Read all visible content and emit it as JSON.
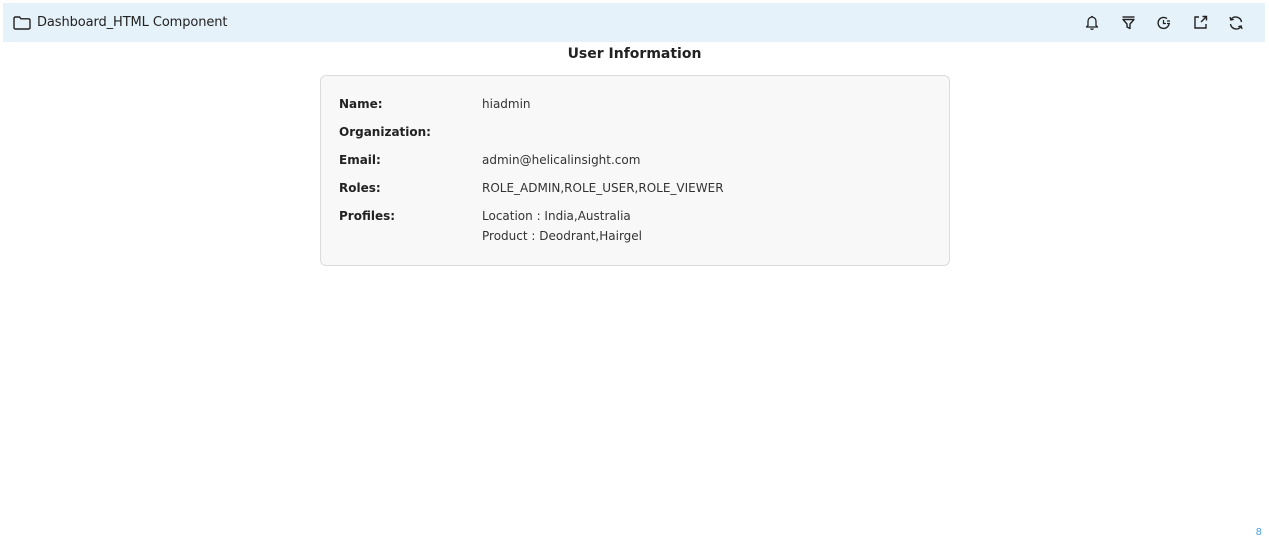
{
  "header": {
    "breadcrumb": "Dashboard_HTML Component",
    "toolbar_icons": [
      "bell-icon",
      "filter-icon",
      "schedule-icon",
      "export-icon",
      "refresh-icon"
    ]
  },
  "main": {
    "title": "User Information",
    "fields": [
      {
        "label": "Name:",
        "value": "hiadmin"
      },
      {
        "label": "Organization:",
        "value": ""
      },
      {
        "label": "Email:",
        "value": "admin@helicalinsight.com"
      },
      {
        "label": "Roles:",
        "value": "ROLE_ADMIN,ROLE_USER,ROLE_VIEWER"
      },
      {
        "label": "Profiles:",
        "values": [
          "Location : India,Australia",
          "Product : Deodrant,Hairgel"
        ]
      }
    ]
  },
  "footer": {
    "corner_mark": "8"
  },
  "colors": {
    "topbar_bg": "#e5f2fa",
    "card_bg": "#f8f8f8",
    "card_border": "#dcdcdc",
    "accent": "#4aa3df"
  }
}
